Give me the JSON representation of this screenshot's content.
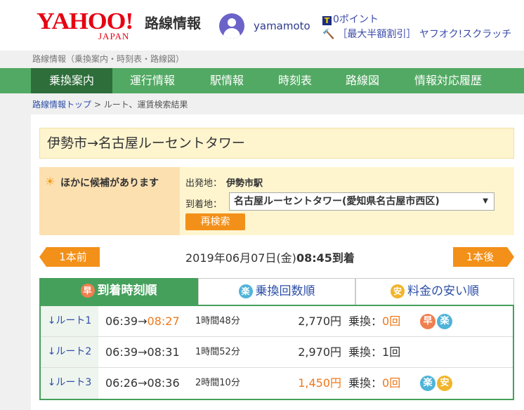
{
  "header": {
    "logo_text": "YAHOO!",
    "logo_sub": "JAPAN",
    "service_name": "路線情報",
    "username": "yamamoto",
    "points_icon": "T",
    "points": "0ポイント",
    "auction_link": "［最大半額割引］ ヤフオク!スクラッチ"
  },
  "breadcrumb_top": "路線情報（乗換案内・時刻表・路線図）",
  "nav": [
    {
      "label": "乗換案内"
    },
    {
      "label": "運行情報"
    },
    {
      "label": "駅情報"
    },
    {
      "label": "時刻表"
    },
    {
      "label": "路線図"
    },
    {
      "label": "情報対応履歴"
    }
  ],
  "breadcrumb": {
    "home": "路線情報トップ",
    "sep": " > ",
    "current": "ルート、運賃検索結果"
  },
  "route_title": "伊勢市→名古屋ルーセントタワー",
  "alternatives": {
    "heading": "ほかに候補があります",
    "from_label": "出発地：",
    "from_value": "伊勢市駅",
    "to_label": "到着地：",
    "to_value": "名古屋ルーセントタワー(愛知県名古屋市西区)",
    "research_button": "再検索"
  },
  "time_nav": {
    "prev": "1本前",
    "next": "1本後",
    "date": "2019年06月07日(金)",
    "time": "08:45到着"
  },
  "tabs": [
    {
      "badge": "早",
      "label": "到着時刻順"
    },
    {
      "badge": "楽",
      "label": "乗換回数順"
    },
    {
      "badge": "安",
      "label": "料金の安い順"
    }
  ],
  "routes": [
    {
      "label": "↓ルート1",
      "dep": "06:39",
      "arrow": "→",
      "arr": "08:27",
      "duration": "1時間48分",
      "fare": "2,770円",
      "transfer_label": "乗換：",
      "transfers": "0回",
      "badges": [
        "早",
        "楽"
      ]
    },
    {
      "label": "↓ルート2",
      "dep": "06:39",
      "arrow": "→",
      "arr": "08:31",
      "duration": "1時間52分",
      "fare": "2,970円",
      "transfer_label": "乗換：",
      "transfers": "1回",
      "badges": []
    },
    {
      "label": "↓ルート3",
      "dep": "06:26",
      "arrow": "→",
      "arr": "08:36",
      "duration": "2時間10分",
      "fare": "1,450円",
      "transfer_label": "乗換：",
      "transfers": "0回",
      "badges": [
        "楽",
        "安"
      ]
    }
  ],
  "colors": {
    "green": "#52a963",
    "dark_green": "#2d6e3a",
    "orange": "#f39019",
    "link": "#2d4fa8",
    "yahoo_red": "#e60012"
  }
}
